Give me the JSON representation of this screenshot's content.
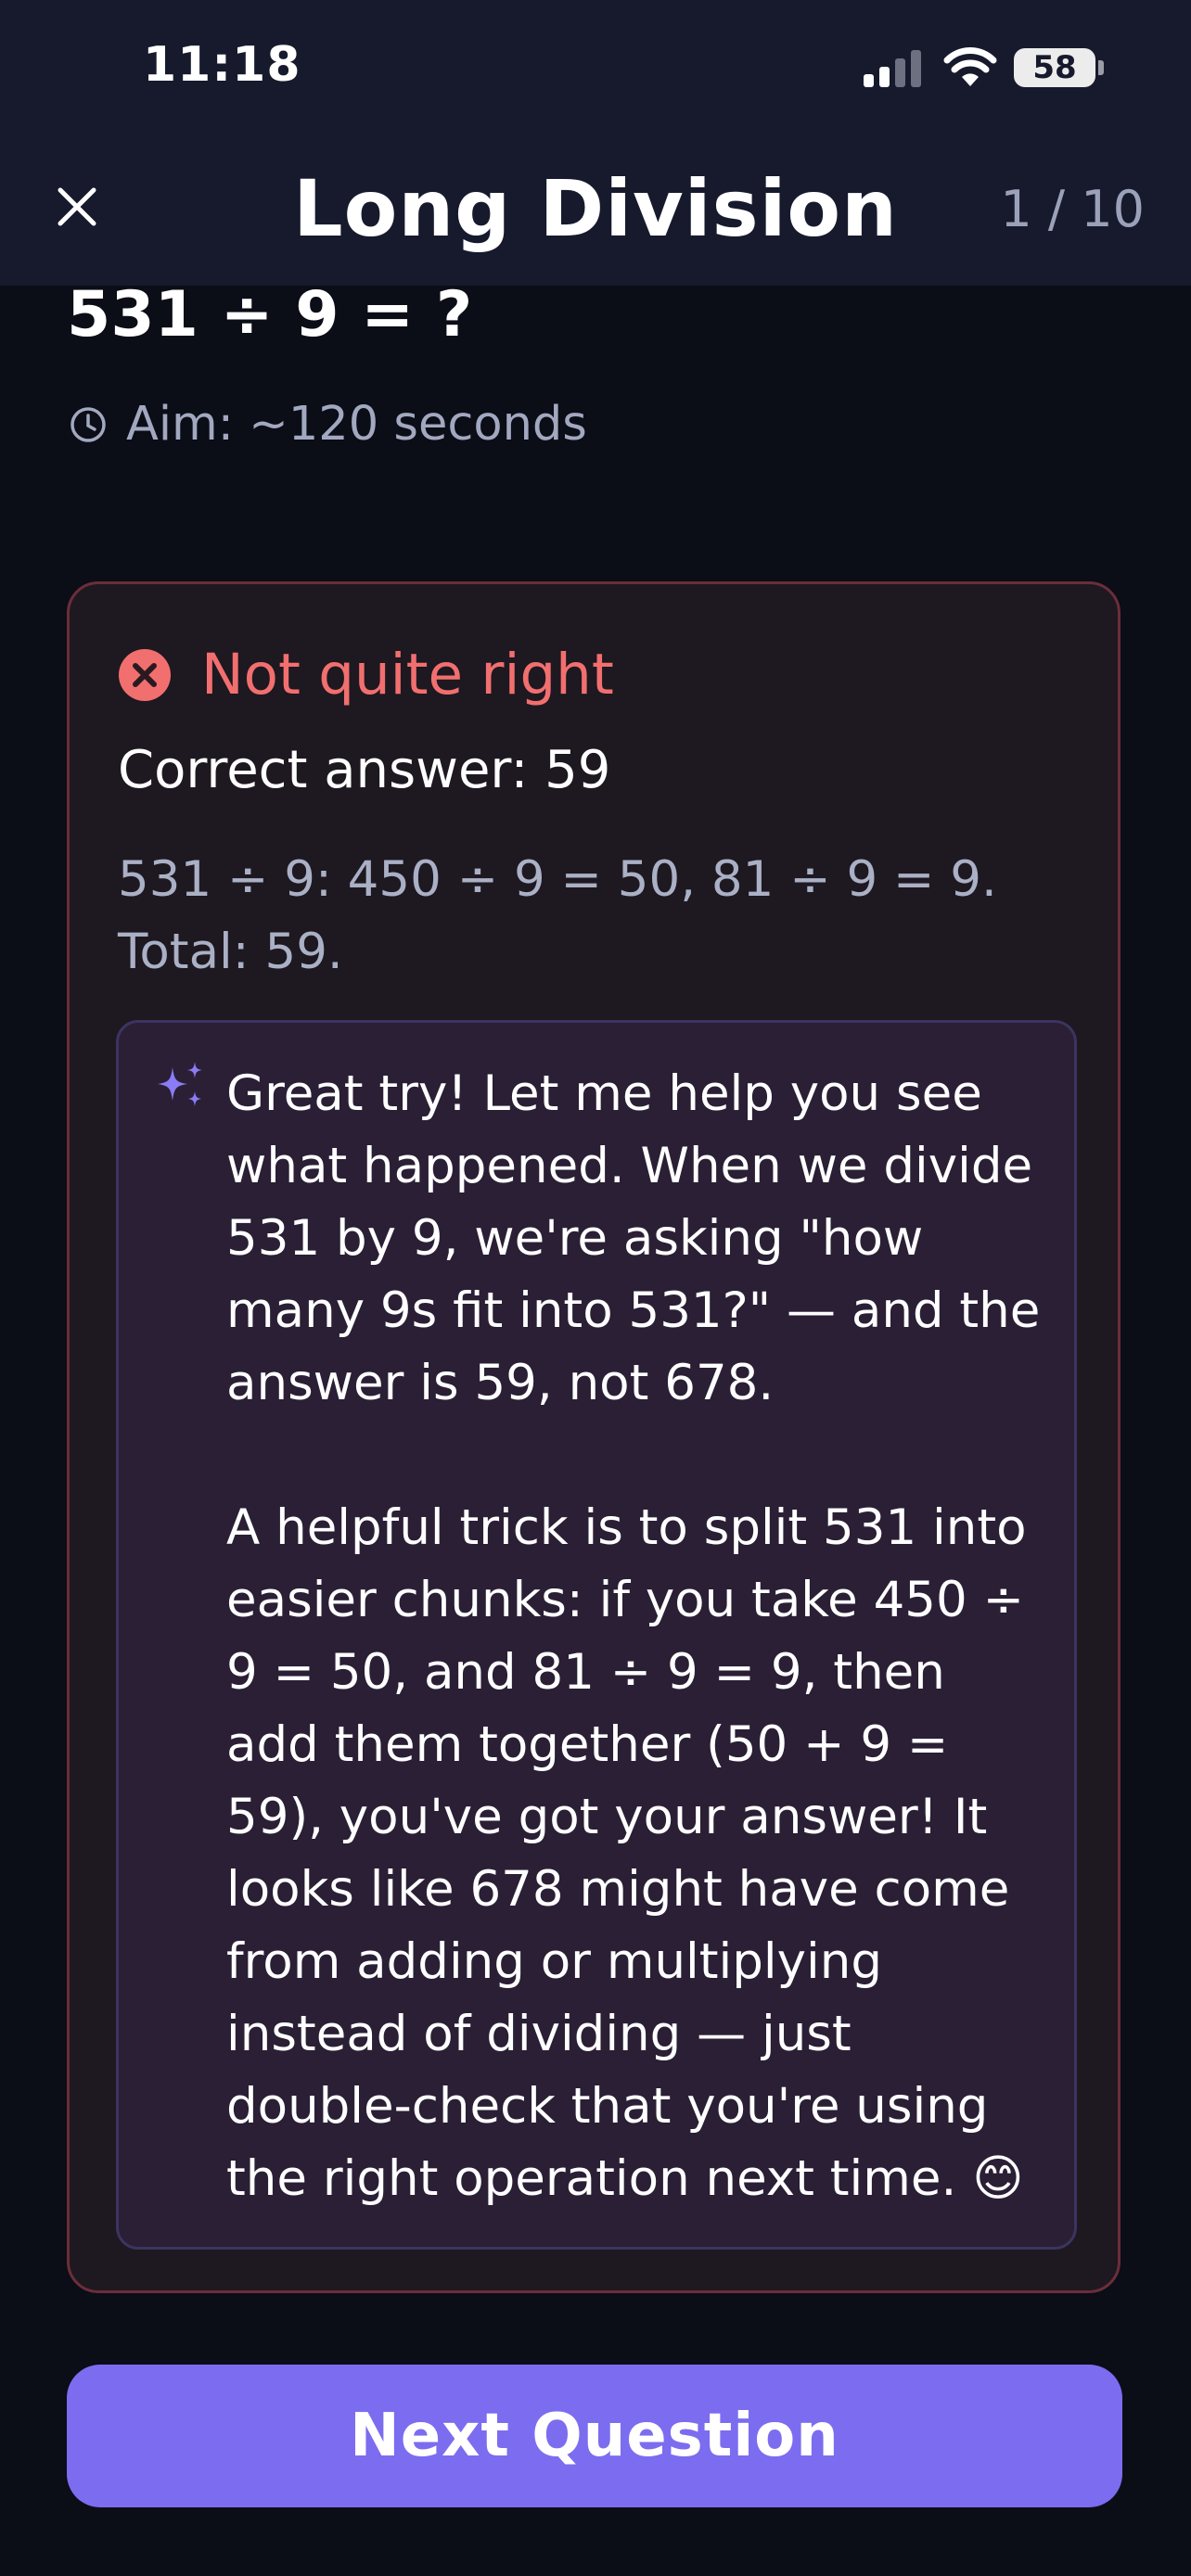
{
  "status_bar": {
    "time": "11:18",
    "battery": "58"
  },
  "nav": {
    "close_icon": "close-icon",
    "title": "Long Division",
    "progress": "1 / 10"
  },
  "question": {
    "text": "531 ÷ 9 = ?",
    "aim_icon": "clock-icon",
    "aim": "Aim: ~120 seconds"
  },
  "feedback": {
    "status_icon": "error-circle-icon",
    "status": "Not quite right",
    "status_color": "#f26f6f",
    "correct_answer": "Correct answer: 59",
    "explanation": "531 ÷ 9: 450 ÷ 9 = 50, 81 ÷ 9 = 9. Total: 59.",
    "ai_icon": "sparkle-icon",
    "ai_message": "Great try! Let me help you see what happened. When we divide 531 by 9, we're asking \"how many 9s fit into 531?\" — and the answer is 59, not 678.\n\nA helpful trick is to split 531 into easier chunks: if you take 450 ÷ 9 = 50, and 81 ÷ 9 = 9, then add them together (50 + 9 = 59), you've got your answer! It looks like 678 might have come from adding or multiplying instead of dividing — just double-check that you're using the right operation next time. 😊"
  },
  "actions": {
    "next_label": "Next Question",
    "accent_color": "#7c6cf0"
  }
}
